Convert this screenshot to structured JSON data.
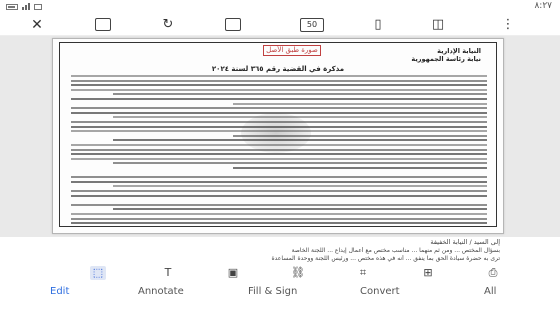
{
  "status_bar": {
    "time": "٨:٢٧"
  },
  "toolbar": {
    "page_count": "50",
    "icons": [
      "close-icon",
      "sidebar-icon",
      "redo-icon",
      "pages-icon",
      "bookmark-icon",
      "view-icon",
      "more-icon"
    ]
  },
  "document": {
    "stamp": "صورة طبق الأصل",
    "header_line_1": "النيابة الإدارية",
    "header_line_2": "نيابة رئاسة الجمهورية",
    "memo_title": "مذكرة في القضية رقم ٣٦٥ لسنة ٢٠٢٤"
  },
  "notes": {
    "line_1": "إلى السيد / النيابة الخفيفة",
    "line_2": "بسؤال المختص ... ومن ثم منهما ... مناسب مختص مع أعمال إيداع ... اللجنة الخاصة",
    "line_3": "ترى به حضرة سيادة الحق بما ينفق ... أنه في هذه مختص ... ورئيس اللجنة ووحدة المساعدة"
  },
  "subtools": {
    "icons": [
      "select-area-icon",
      "text-icon",
      "image-icon",
      "link-icon",
      "crop-icon",
      "add-page-icon",
      "ocr-icon"
    ]
  },
  "tabs": [
    {
      "label": "Edit",
      "active": true
    },
    {
      "label": "Annotate",
      "active": false
    },
    {
      "label": "Fill & Sign",
      "active": false
    },
    {
      "label": "Convert",
      "active": false
    },
    {
      "label": "All",
      "active": false
    }
  ],
  "colors": {
    "accent": "#2f6fe0",
    "canvas": "#e9e9e9",
    "stamp": "#c04040"
  }
}
